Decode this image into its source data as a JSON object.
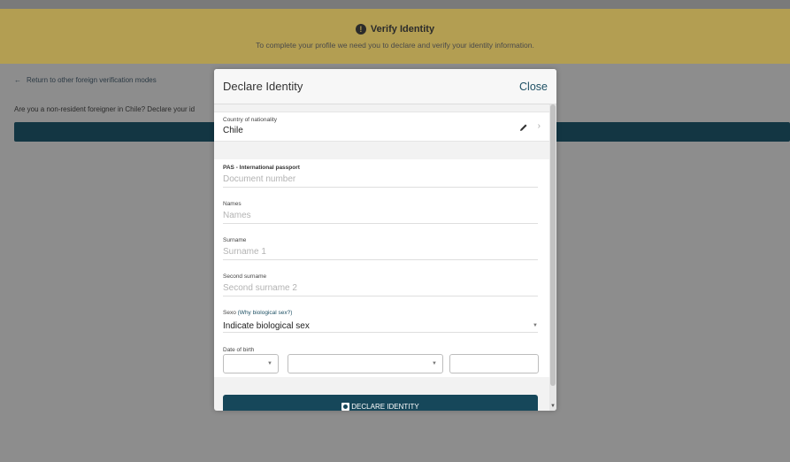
{
  "banner": {
    "title": "Verify Identity",
    "subtitle": "To complete your profile we need you to declare and verify your identity information.",
    "bg_color": "#b39e52"
  },
  "page": {
    "back_link": "Return to other foreign verification modes",
    "question": "Are you a non-resident foreigner in Chile? Declare your id"
  },
  "modal": {
    "title": "Declare Identity",
    "close_label": "Close",
    "nationality": {
      "label": "Country of nationality",
      "value": "Chile"
    },
    "document": {
      "label": "PAS - International passport",
      "placeholder": "Document number"
    },
    "names": {
      "label": "Names",
      "placeholder": "Names"
    },
    "surname": {
      "label": "Surname",
      "placeholder": "Surname 1"
    },
    "second_surname": {
      "label": "Second surname",
      "placeholder": "Second surname 2"
    },
    "sex": {
      "label_prefix": "Sexo",
      "label_link": "(Why biological sex?)",
      "value": "Indicate biological sex"
    },
    "dob": {
      "label": "Date of birth"
    },
    "submit_label": "DECLARE IDENTITY",
    "accent_color": "#16475a"
  }
}
